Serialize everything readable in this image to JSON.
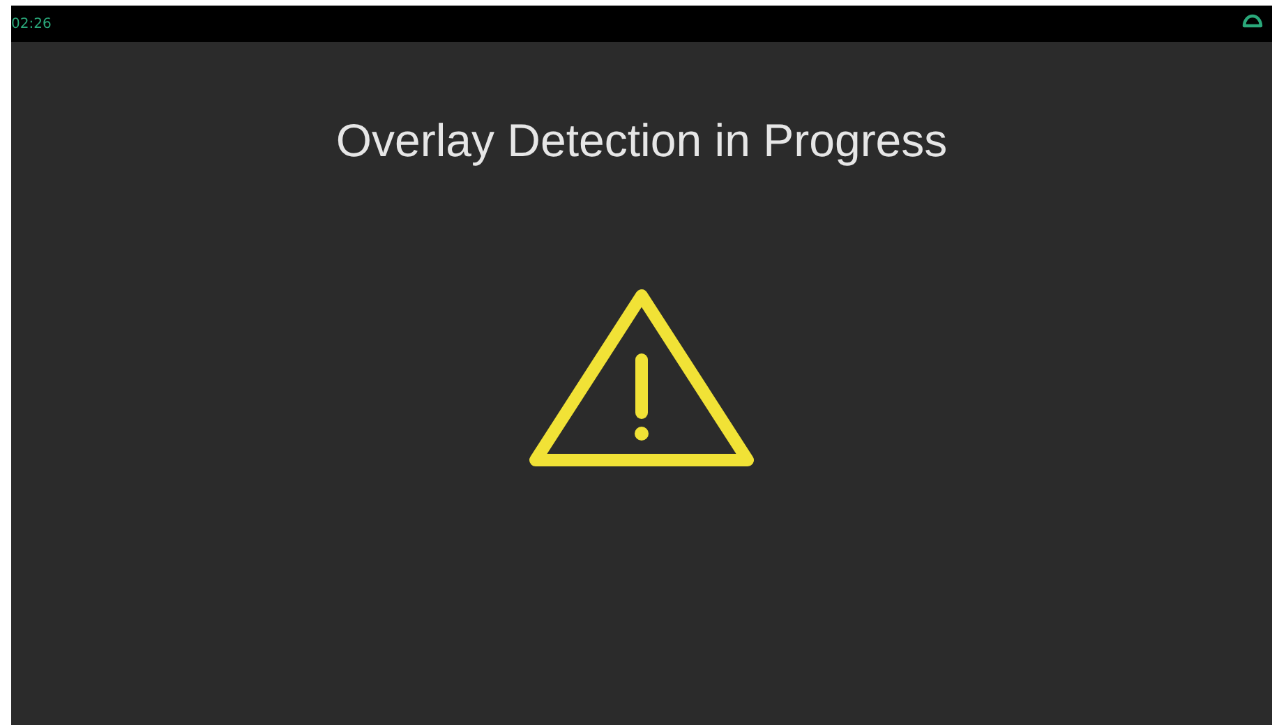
{
  "status_bar": {
    "time": "02:26"
  },
  "title": "Overlay Detection in Progress"
}
